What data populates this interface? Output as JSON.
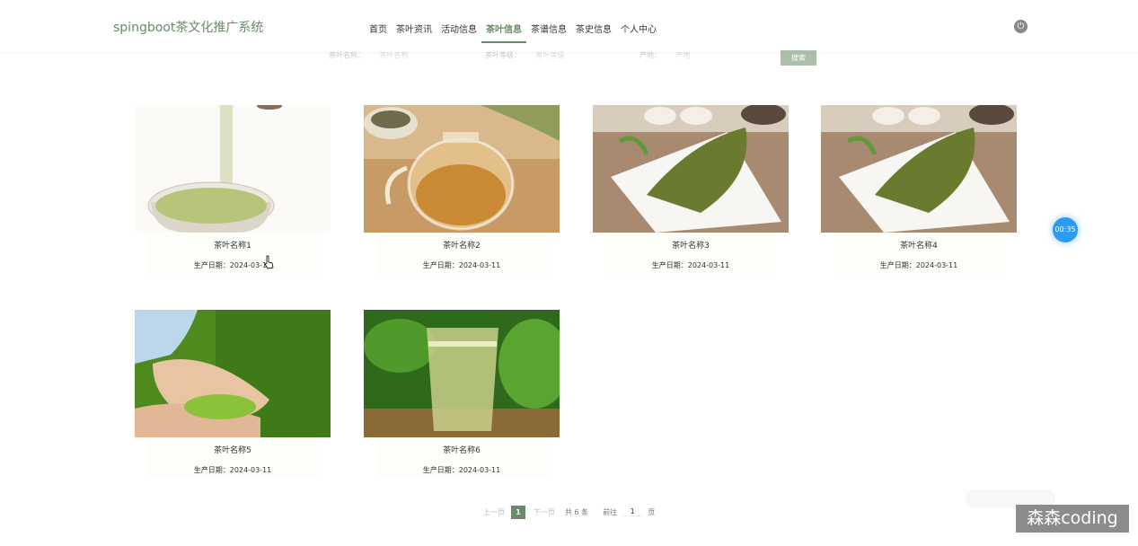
{
  "app": {
    "brand": "spingboot茶文化推广系统"
  },
  "nav": {
    "items": [
      "首页",
      "茶叶资讯",
      "活动信息",
      "茶叶信息",
      "茶谱信息",
      "茶史信息",
      "个人中心"
    ],
    "active_index": 3
  },
  "search": {
    "fields": [
      {
        "label": "茶叶名称：",
        "placeholder": "茶叶名称"
      },
      {
        "label": "茶叶等级：",
        "placeholder": "茶叶等级"
      },
      {
        "label": "产地：",
        "placeholder": "产地"
      }
    ],
    "button_label": "搜索"
  },
  "cards": [
    {
      "name": "茶叶名称1",
      "date": "生产日期：2024-03-11",
      "image": "pouring-tea-cup"
    },
    {
      "name": "茶叶名称2",
      "date": "生产日期：2024-03-11",
      "image": "glass-teapot-flower-tea"
    },
    {
      "name": "茶叶名称3",
      "date": "生产日期：2024-03-11",
      "image": "green-tea-leaves-spoon"
    },
    {
      "name": "茶叶名称4",
      "date": "生产日期：2024-03-11",
      "image": "green-tea-leaves-spoon"
    },
    {
      "name": "茶叶名称5",
      "date": "生产日期：2024-03-11",
      "image": "hands-holding-tea-leaves"
    },
    {
      "name": "茶叶名称6",
      "date": "生产日期：2024-03-11",
      "image": "glass-green-tea"
    }
  ],
  "pagination": {
    "prev": "上一页",
    "current": "1",
    "next": "下一页",
    "total": "共 6 条",
    "goto_label": "前往",
    "goto_value": "1",
    "page_suffix": "页"
  },
  "timer": "00:35",
  "watermark": "森森coding",
  "colors": {
    "accent": "#6a8a69",
    "timer": "#2d9cf0"
  }
}
